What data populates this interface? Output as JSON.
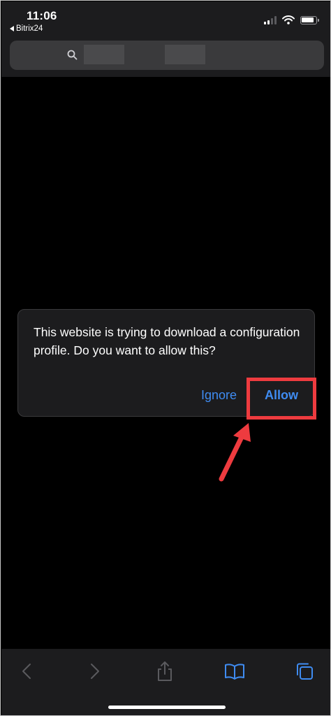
{
  "status_bar": {
    "time": "11:06",
    "back_app": "Bitrix24"
  },
  "search": {
    "icon": "search-icon"
  },
  "dialog": {
    "message": "This website is trying to download a configuration profile. Do you want to allow this?",
    "ignore_label": "Ignore",
    "allow_label": "Allow"
  },
  "colors": {
    "accent": "#3f8cf2",
    "highlight": "#ee3b3f",
    "background": "#000000",
    "chrome": "#1c1c1e"
  },
  "toolbar": {
    "icons": [
      "back-icon",
      "forward-icon",
      "share-icon",
      "bookmarks-icon",
      "tabs-icon"
    ]
  }
}
